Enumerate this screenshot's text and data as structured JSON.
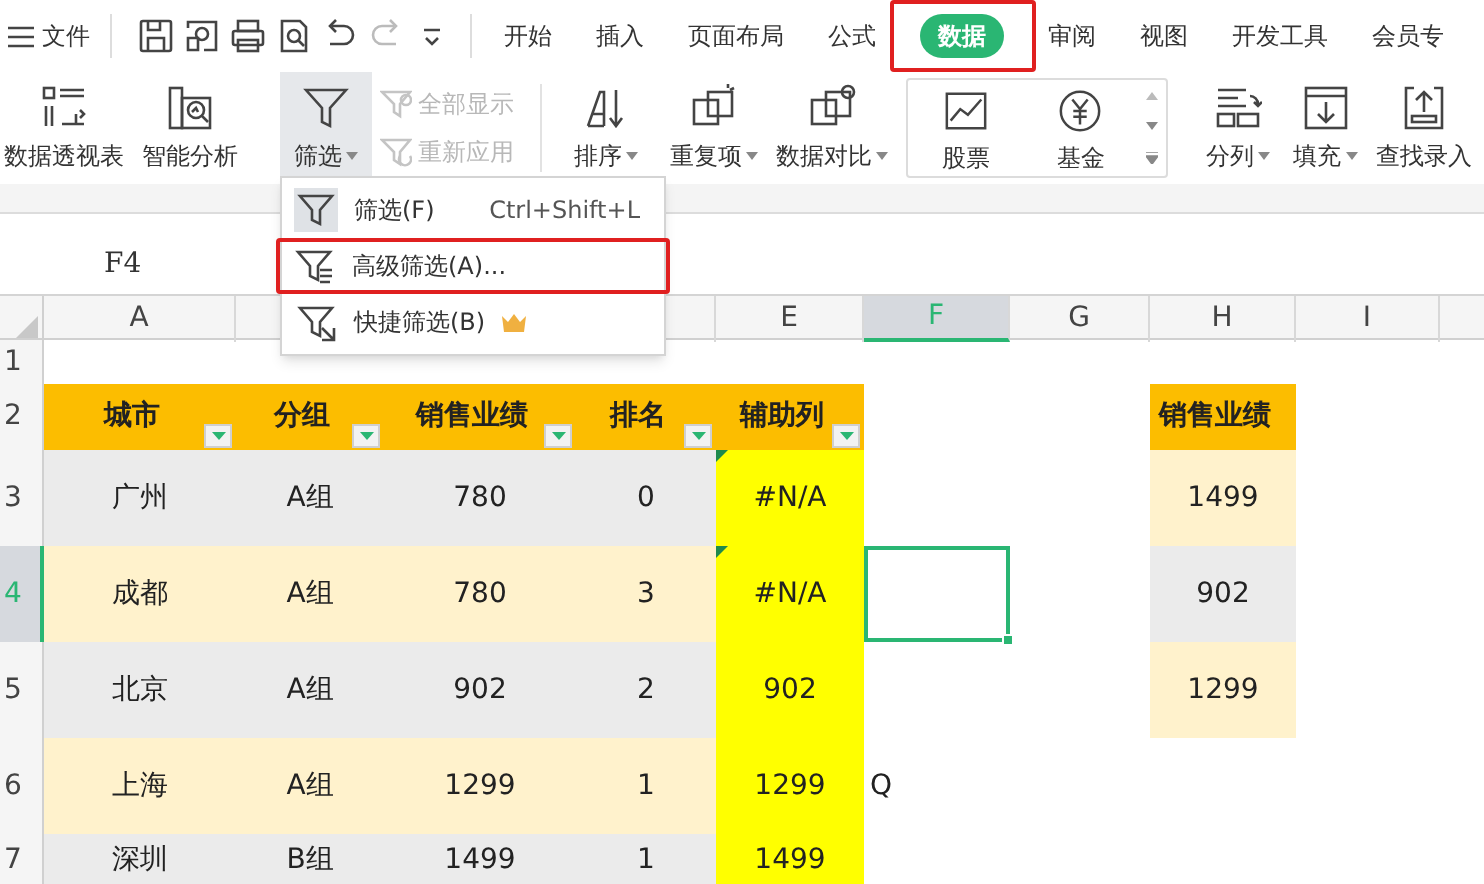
{
  "menu_bar": {
    "menu_label": "文件",
    "tabs": [
      {
        "label": "开始",
        "selected": false,
        "outlined": false
      },
      {
        "label": "插入",
        "selected": false,
        "outlined": false
      },
      {
        "label": "页面布局",
        "selected": false,
        "outlined": false
      },
      {
        "label": "公式",
        "selected": false,
        "outlined": false
      },
      {
        "label": "数据",
        "selected": true,
        "outlined": true
      },
      {
        "label": "审阅",
        "selected": false,
        "outlined": false
      },
      {
        "label": "视图",
        "selected": false,
        "outlined": false
      },
      {
        "label": "开发工具",
        "selected": false,
        "outlined": false
      },
      {
        "label": "会员专",
        "selected": false,
        "outlined": false
      }
    ]
  },
  "ribbon": {
    "items": [
      {
        "kind": "large",
        "label": "数据透视表",
        "dropdown": false,
        "selected": false
      },
      {
        "kind": "large",
        "label": "智能分析",
        "dropdown": false,
        "selected": false
      },
      {
        "kind": "large",
        "label": "筛选",
        "dropdown": true,
        "selected": true
      },
      {
        "kind": "stack",
        "entries": [
          {
            "label": "全部显示",
            "disabled": true
          },
          {
            "label": "重新应用",
            "disabled": true
          }
        ]
      },
      {
        "kind": "large",
        "label": "排序",
        "dropdown": true,
        "selected": false
      },
      {
        "kind": "large",
        "label": "重复项",
        "dropdown": true,
        "selected": false
      },
      {
        "kind": "large",
        "label": "数据对比",
        "dropdown": true,
        "selected": false
      },
      {
        "kind": "gallery",
        "entries": [
          {
            "label": "股票"
          },
          {
            "label": "基金"
          }
        ]
      },
      {
        "kind": "large",
        "label": "分列",
        "dropdown": true,
        "selected": false
      },
      {
        "kind": "large",
        "label": "填充",
        "dropdown": true,
        "selected": false
      },
      {
        "kind": "large",
        "label": "查找录入",
        "dropdown": false,
        "selected": false
      }
    ]
  },
  "filter_menu": {
    "items": [
      {
        "label": "筛选(F)",
        "shortcut": "Ctrl+Shift+L",
        "hovered": true,
        "outlined": false,
        "premium": false
      },
      {
        "label": "高级筛选(A)...",
        "hovered": false,
        "outlined": true,
        "premium": false
      },
      {
        "label": "快捷筛选(B)",
        "hovered": false,
        "outlined": false,
        "premium": true
      }
    ]
  },
  "name_box": {
    "value": "F4"
  },
  "sheet": {
    "columns": [
      {
        "kind": "letter",
        "label": "A",
        "selected": false
      },
      {
        "kind": "covered"
      },
      {
        "kind": "covered"
      },
      {
        "kind": "covered"
      },
      {
        "kind": "letter",
        "label": "E",
        "selected": false
      },
      {
        "kind": "letter",
        "label": "F",
        "selected": true
      },
      {
        "kind": "letter",
        "label": "G",
        "selected": false
      },
      {
        "kind": "letter",
        "label": "H",
        "selected": false
      },
      {
        "kind": "letter",
        "label": "I",
        "selected": false
      }
    ],
    "rows": [
      {
        "number": "1",
        "selected": false,
        "cells": [
          {
            "kind": "blank"
          },
          {
            "kind": "blank"
          },
          {
            "kind": "blank"
          },
          {
            "kind": "blank"
          },
          {
            "kind": "blank"
          },
          {
            "kind": "blank"
          },
          {
            "kind": "blank"
          },
          {
            "kind": "blank"
          },
          {
            "kind": "blank"
          }
        ]
      },
      {
        "number": "2",
        "selected": false,
        "cells": [
          {
            "kind": "header",
            "text": "城市",
            "filter_button": true
          },
          {
            "kind": "header",
            "text": "分组",
            "filter_button": true
          },
          {
            "kind": "header",
            "text": "销售业绩",
            "filter_button": true
          },
          {
            "kind": "header",
            "text": "排名",
            "filter_button": true
          },
          {
            "kind": "header",
            "text": "辅助列",
            "filter_button": true
          },
          {
            "kind": "blank"
          },
          {
            "kind": "blank"
          },
          {
            "kind": "header",
            "text": "销售业绩",
            "filter_button": false
          },
          {
            "kind": "blank"
          }
        ]
      },
      {
        "number": "3",
        "selected": false,
        "cells": [
          {
            "kind": "gray",
            "text": "广州"
          },
          {
            "kind": "gray",
            "text": "A组"
          },
          {
            "kind": "gray",
            "text": "780"
          },
          {
            "kind": "gray",
            "text": "0"
          },
          {
            "kind": "helper",
            "text": "#N/A",
            "error_flag": true
          },
          {
            "kind": "blank"
          },
          {
            "kind": "blank"
          },
          {
            "kind": "cream",
            "text": "1499"
          },
          {
            "kind": "blank"
          }
        ]
      },
      {
        "number": "4",
        "selected": true,
        "cells": [
          {
            "kind": "cream",
            "text": "成都"
          },
          {
            "kind": "cream",
            "text": "A组"
          },
          {
            "kind": "cream",
            "text": "780"
          },
          {
            "kind": "cream",
            "text": "3"
          },
          {
            "kind": "helper",
            "text": "#N/A",
            "error_flag": true
          },
          {
            "kind": "active"
          },
          {
            "kind": "blank"
          },
          {
            "kind": "gray",
            "text": "902"
          },
          {
            "kind": "blank"
          }
        ]
      },
      {
        "number": "5",
        "selected": false,
        "cells": [
          {
            "kind": "gray",
            "text": "北京"
          },
          {
            "kind": "gray",
            "text": "A组"
          },
          {
            "kind": "gray",
            "text": "902"
          },
          {
            "kind": "gray",
            "text": "2"
          },
          {
            "kind": "helper",
            "text": "902",
            "error_flag": false
          },
          {
            "kind": "blank"
          },
          {
            "kind": "blank"
          },
          {
            "kind": "cream",
            "text": "1299"
          },
          {
            "kind": "blank"
          }
        ]
      },
      {
        "number": "6",
        "selected": false,
        "cells": [
          {
            "kind": "cream",
            "text": "上海"
          },
          {
            "kind": "cream",
            "text": "A组"
          },
          {
            "kind": "cream",
            "text": "1299"
          },
          {
            "kind": "cream",
            "text": "1"
          },
          {
            "kind": "helper",
            "text": "1299",
            "error_flag": false
          },
          {
            "kind": "plain",
            "text": "Q"
          },
          {
            "kind": "blank"
          },
          {
            "kind": "blank"
          },
          {
            "kind": "blank"
          }
        ]
      },
      {
        "number": "7",
        "selected": false,
        "cells": [
          {
            "kind": "gray",
            "text": "深圳"
          },
          {
            "kind": "gray",
            "text": "B组"
          },
          {
            "kind": "gray",
            "text": "1499"
          },
          {
            "kind": "gray",
            "text": "1"
          },
          {
            "kind": "helper",
            "text": "1499",
            "error_flag": false
          },
          {
            "kind": "blank"
          },
          {
            "kind": "blank"
          },
          {
            "kind": "blank"
          },
          {
            "kind": "blank"
          }
        ]
      }
    ]
  }
}
